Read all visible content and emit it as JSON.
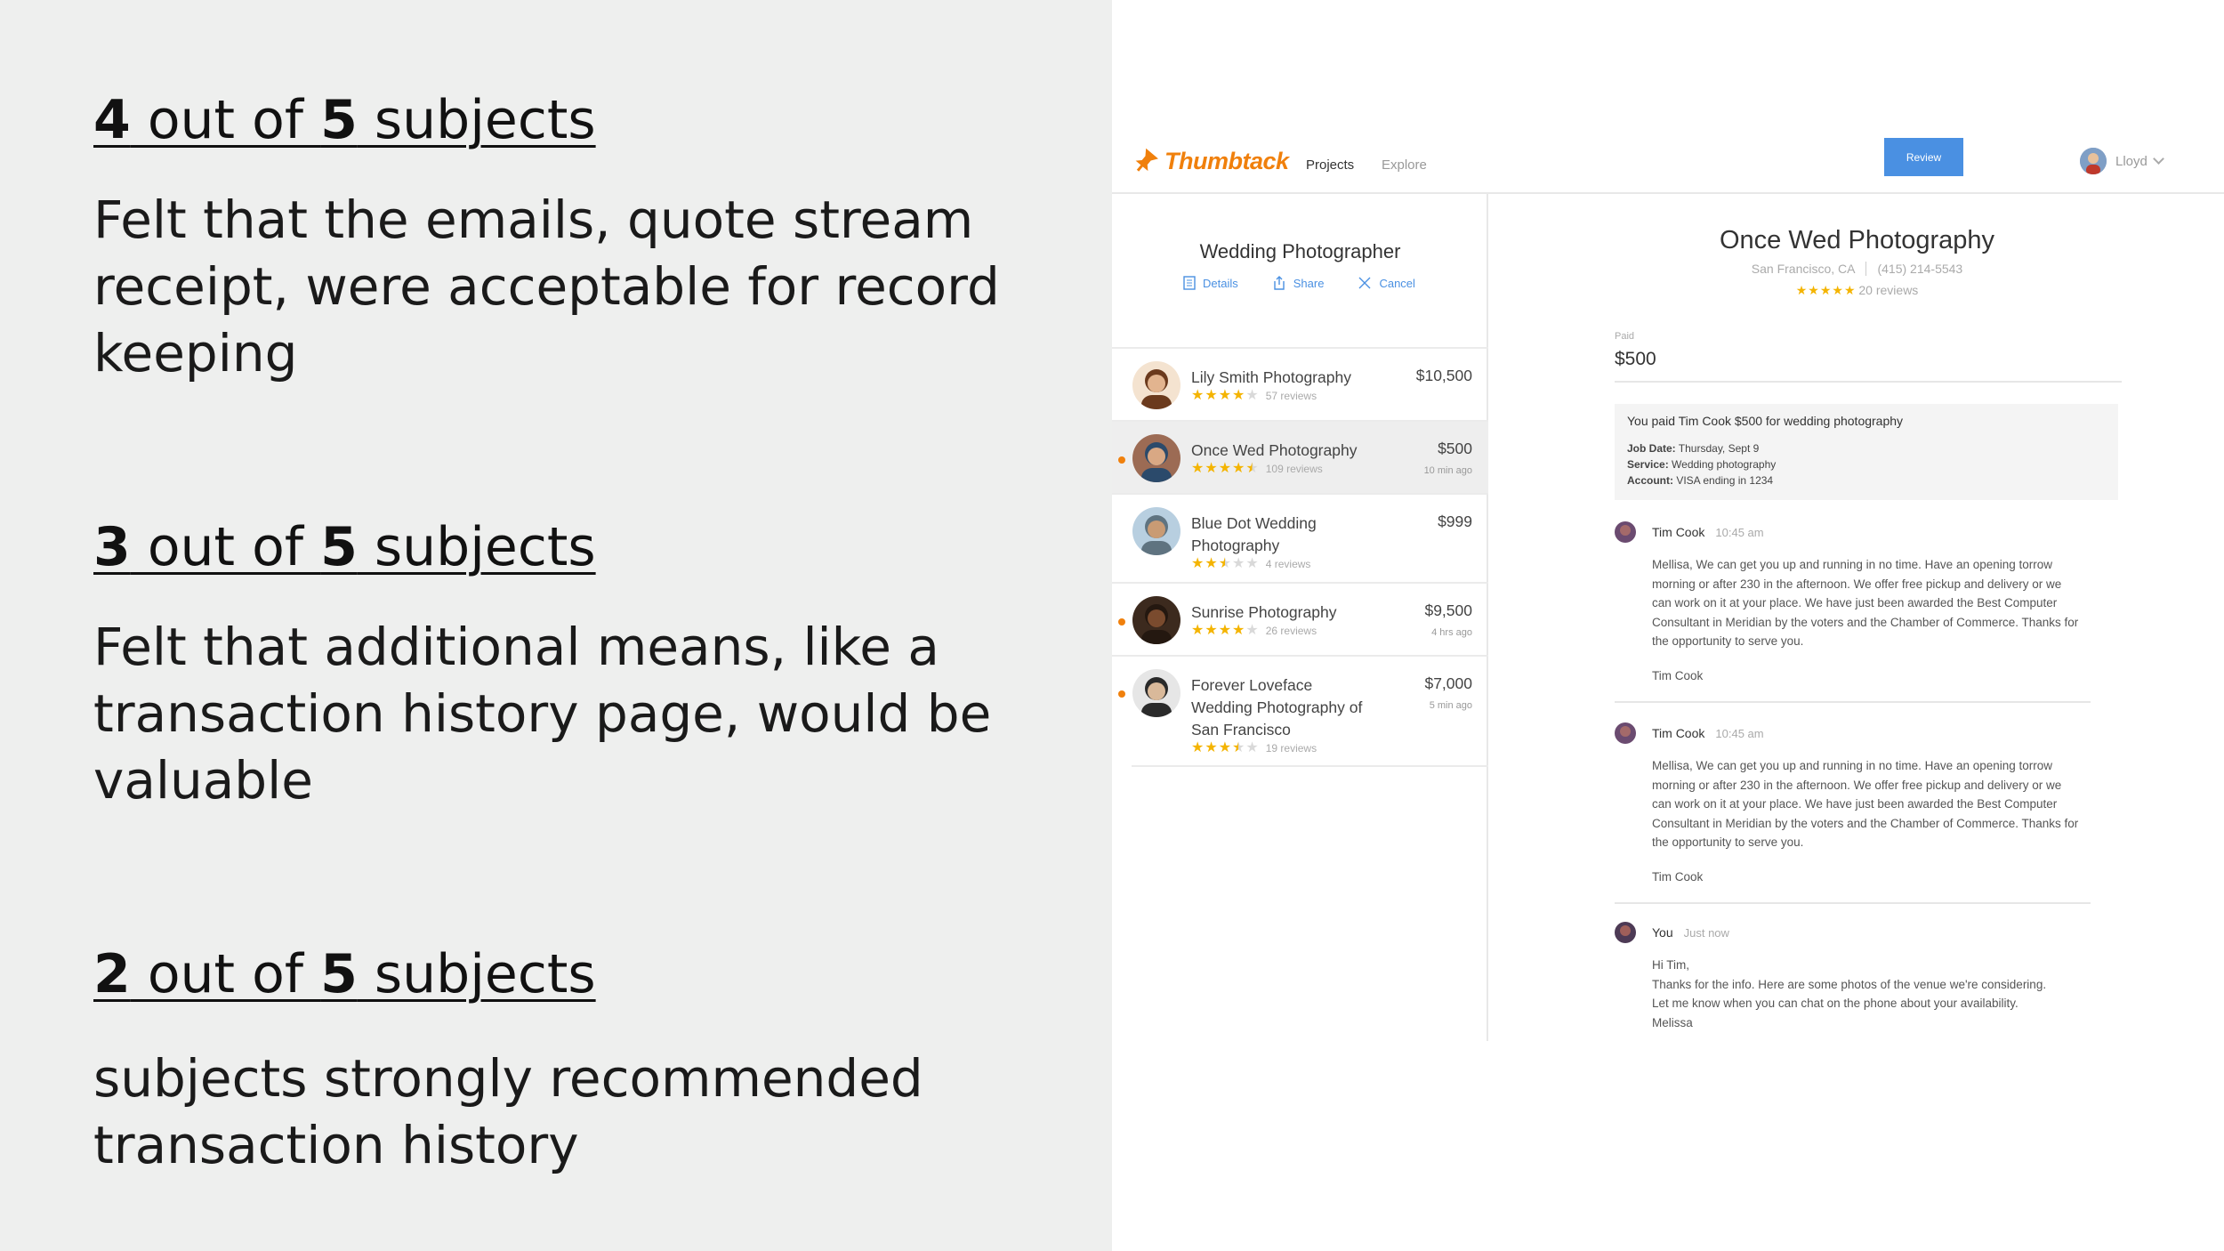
{
  "findings": [
    {
      "count": "4",
      "total": "5",
      "mid": " out of ",
      "suffix": " subjects",
      "text": "Felt that the emails, quote stream receipt, were acceptable for record keeping"
    },
    {
      "count": "3",
      "total": "5",
      "mid": " out of ",
      "suffix": " subjects",
      "text": "Felt that additional means, like a transaction history page, would be valuable"
    },
    {
      "count": "2",
      "total": "5",
      "mid": " out of ",
      "suffix": " subjects",
      "text": "subjects strongly recommended transaction history"
    }
  ],
  "app": {
    "brand": "Thumbtack",
    "nav": {
      "projects": "Projects",
      "explore": "Explore"
    },
    "user": {
      "name": "Lloyd"
    },
    "colors": {
      "brand": "#f0800c",
      "accent": "#4a90e2",
      "star": "#f4b400"
    },
    "project": {
      "title": "Wedding Photographer",
      "actions": {
        "details": "Details",
        "share": "Share",
        "cancel": "Cancel"
      },
      "pros": [
        {
          "name": "Lily Smith Photography",
          "price": "$10,500",
          "rating": 4,
          "reviews": "57 reviews",
          "time": "",
          "unread": false,
          "selected": false
        },
        {
          "name": "Once Wed Photography",
          "price": "$500",
          "rating": 4.5,
          "reviews": "109 reviews",
          "time": "10 min ago",
          "unread": true,
          "selected": true
        },
        {
          "name": "Blue Dot Wedding Photography",
          "price": "$999",
          "rating": 2.5,
          "reviews": "4 reviews",
          "time": "",
          "unread": false,
          "selected": false
        },
        {
          "name": "Sunrise Photography",
          "price": "$9,500",
          "rating": 4,
          "reviews": "26 reviews",
          "time": "4 hrs ago",
          "unread": true,
          "selected": false
        },
        {
          "name": "Forever Loveface Wedding Photography of San Francisco",
          "price": "$7,000",
          "rating": 3.5,
          "reviews": "19 reviews",
          "time": "5 min ago",
          "unread": true,
          "selected": false
        }
      ]
    },
    "detail": {
      "business": "Once Wed Photography",
      "location": "San Francisco, CA",
      "phone": "(415) 214-5543",
      "rating": 5,
      "reviews": "20 reviews",
      "paid_label": "Paid",
      "paid_amount": "$500",
      "review_button": "Review",
      "receipt": {
        "headline": "You paid Tim Cook $500 for wedding photography",
        "job_date_label": "Job Date:",
        "job_date": " Thursday, Sept 9",
        "service_label": "Service:",
        "service": " Wedding photography",
        "account_label": "Account:",
        "account": " VISA ending in 1234"
      },
      "messages": [
        {
          "sender": "Tim Cook",
          "time": "10:45 am",
          "body": "Mellisa, We can get you up and running in no time. Have an opening torrow\nmorning or after 230 in the afternoon. We offer free pickup and delivery or we\ncan work on it at your place. We have just been awarded the Best Computer\nConsultant in Meridian by the voters and the Chamber of Commerce. Thanks for\nthe opportunity to serve you.",
          "signature": "Tim Cook"
        },
        {
          "sender": "Tim Cook",
          "time": "10:45 am",
          "body": "Mellisa, We can get you up and running in no time. Have an opening torrow\nmorning or after 230 in the afternoon. We offer free pickup and delivery or we\ncan work on it at your place. We have just been awarded the Best Computer\nConsultant in Meridian by the voters and the Chamber of Commerce. Thanks for\nthe opportunity to serve you.",
          "signature": "Tim Cook"
        },
        {
          "sender": "You",
          "time": "Just now",
          "body": "Hi Tim,\nThanks for the info. Here are some photos of the venue we're considering.\nLet me know when you can chat on the phone about your availability.\nMelissa",
          "signature": ""
        }
      ]
    }
  }
}
